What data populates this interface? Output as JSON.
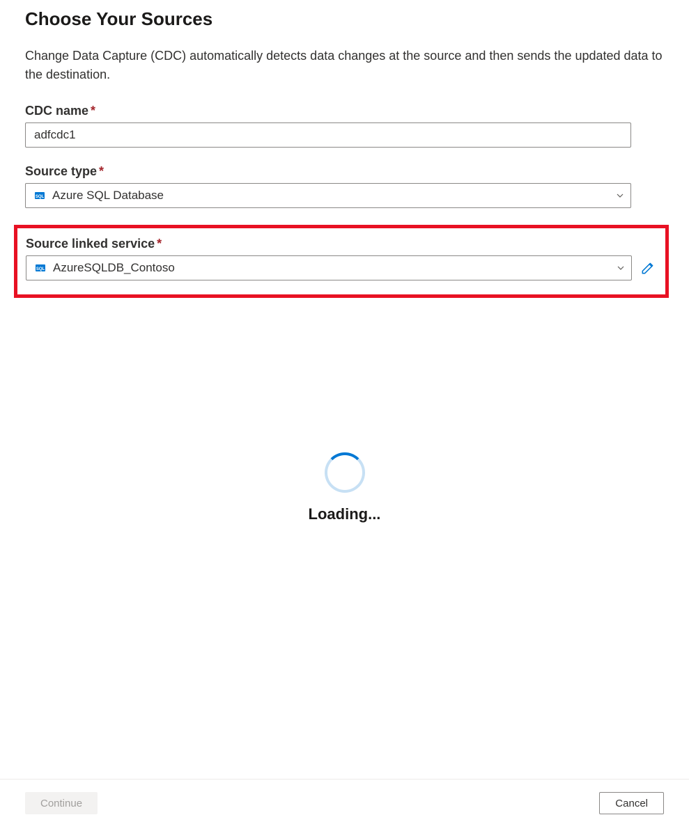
{
  "page": {
    "title": "Choose Your Sources",
    "description": "Change Data Capture (CDC) automatically detects data changes at the source and then sends the updated data to the destination."
  },
  "fields": {
    "cdc_name": {
      "label": "CDC name",
      "value": "adfcdc1"
    },
    "source_type": {
      "label": "Source type",
      "value": "Azure SQL Database",
      "icon": "sql-database-icon"
    },
    "source_linked_service": {
      "label": "Source linked service",
      "value": "AzureSQLDB_Contoso",
      "icon": "sql-database-icon"
    }
  },
  "loading": {
    "text": "Loading..."
  },
  "footer": {
    "continue_label": "Continue",
    "cancel_label": "Cancel"
  },
  "colors": {
    "highlight": "#e81123",
    "accent": "#0078d4",
    "required": "#a4262c"
  }
}
